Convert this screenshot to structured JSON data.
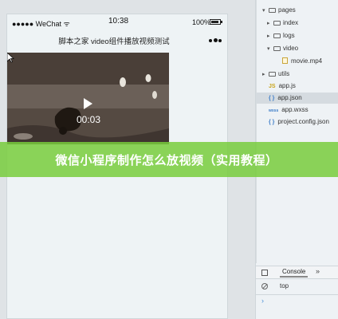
{
  "status_bar": {
    "carrier": "●●●●● WeChat ᯤ",
    "time": "10:38",
    "battery": "100%"
  },
  "nav": {
    "title": "脚本之家 video组件播放视频测试"
  },
  "video": {
    "duration": "00:03"
  },
  "file_tree": [
    {
      "label": "pages",
      "type": "folder",
      "expanded": true
    },
    {
      "label": "index",
      "type": "folder",
      "expanded": false
    },
    {
      "label": "logs",
      "type": "folder",
      "expanded": false
    },
    {
      "label": "video",
      "type": "folder",
      "expanded": true
    },
    {
      "label": "movie.mp4",
      "type": "file"
    },
    {
      "label": "utils",
      "type": "folder",
      "expanded": false
    },
    {
      "label": "app.js",
      "type": "js",
      "icon": "JS"
    },
    {
      "label": "app.json",
      "type": "json",
      "icon": "{ }"
    },
    {
      "label": "app.wxss",
      "type": "wxss",
      "icon": "wxss"
    },
    {
      "label": "project.config.json",
      "type": "json",
      "icon": "{ }"
    }
  ],
  "console": {
    "tab_label": "Console",
    "more_tabs": "»",
    "context": "top",
    "prompt": "›"
  },
  "banner": {
    "text": "微信小程序制作怎么放视频（实用教程）"
  },
  "colors": {
    "banner_green": "#78cd3c",
    "selected_row": "#d5dbe0"
  }
}
